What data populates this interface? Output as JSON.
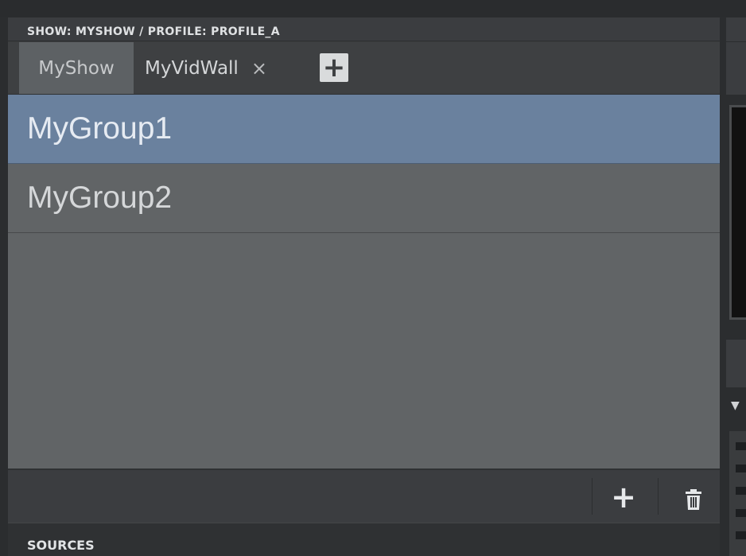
{
  "header": {
    "title": "SHOW: MYSHOW / PROFILE: PROFILE_A"
  },
  "tabs": [
    {
      "label": "MyShow",
      "active": true
    },
    {
      "label": "MyVidWall",
      "active": false,
      "close_glyph": "×"
    }
  ],
  "add_tab_glyph": "+",
  "groups": [
    {
      "label": "MyGroup1",
      "selected": true
    },
    {
      "label": "MyGroup2",
      "selected": false
    }
  ],
  "footer": {
    "add_glyph": "+",
    "delete_icon": "trash-icon"
  },
  "sources": {
    "label": "SOURCES"
  },
  "colors": {
    "selected_row": "#6a819e",
    "list_bg": "#616466",
    "panel_bg": "#3b3d40"
  }
}
